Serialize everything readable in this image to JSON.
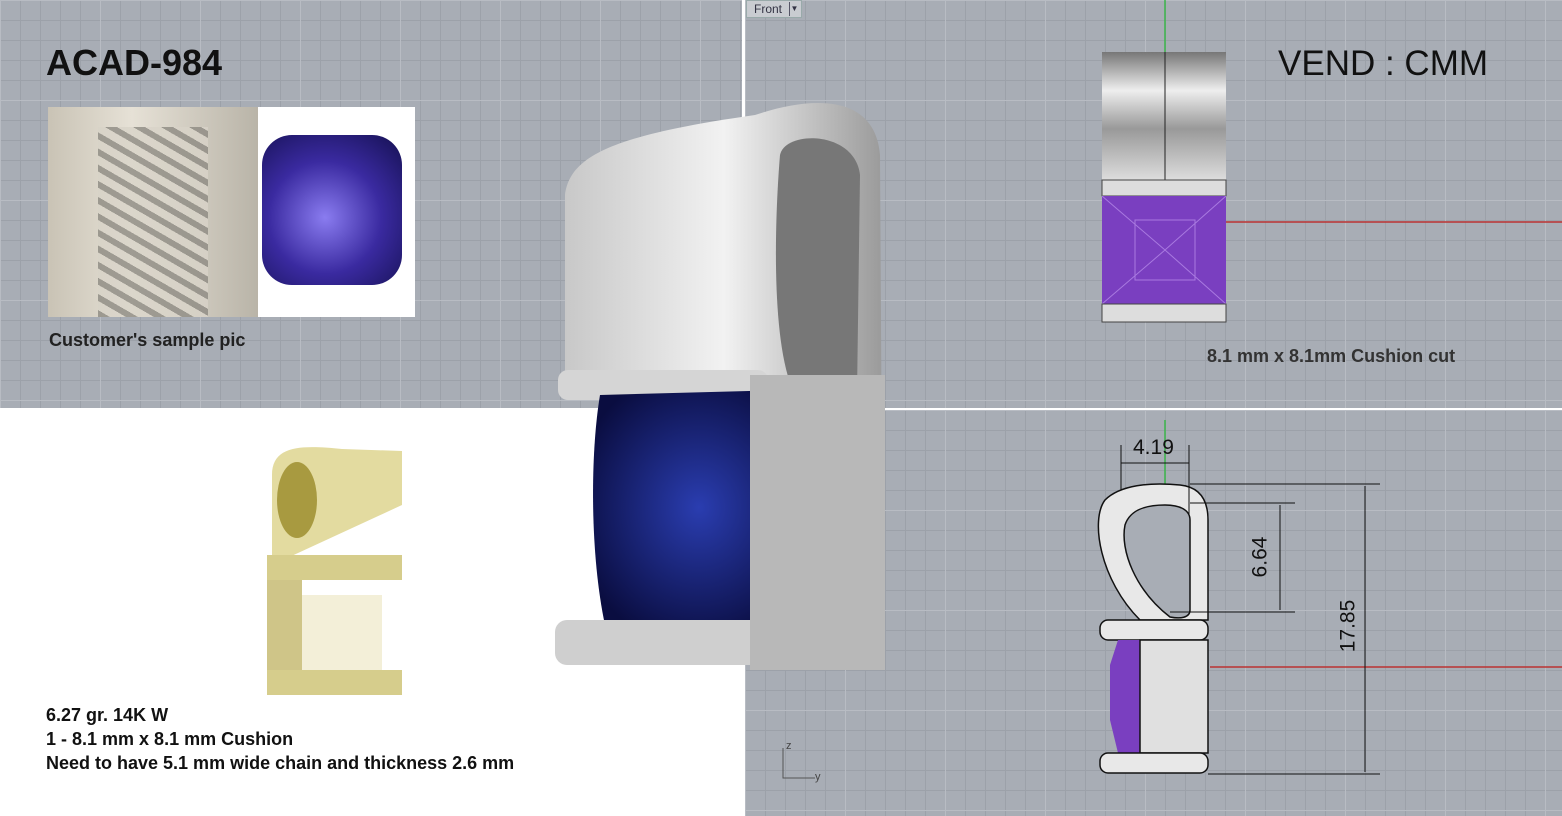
{
  "title": "ACAD-984",
  "vendor": "VEND : CMM",
  "sample_caption": "Customer's sample pic",
  "stone_caption": "8.1 mm x 8.1mm Cushion cut",
  "viewport": {
    "label": "Front",
    "dropdown_icon": "triangle-down"
  },
  "specs": [
    "6.27 gr. 14K W",
    "1 - 8.1 mm x 8.1 mm Cushion",
    "Need to have 5.1 mm wide chain and thickness 2.6 mm"
  ],
  "dimensions": {
    "width": "4.19",
    "bail": "6.64",
    "height": "17.85"
  },
  "axes": {
    "z": "z",
    "y": "y"
  },
  "colors": {
    "grid": "#a8adb5",
    "stone": "#7a3fc0",
    "sapphire": "#1a1f8a",
    "gold": "#d8cf8a"
  }
}
